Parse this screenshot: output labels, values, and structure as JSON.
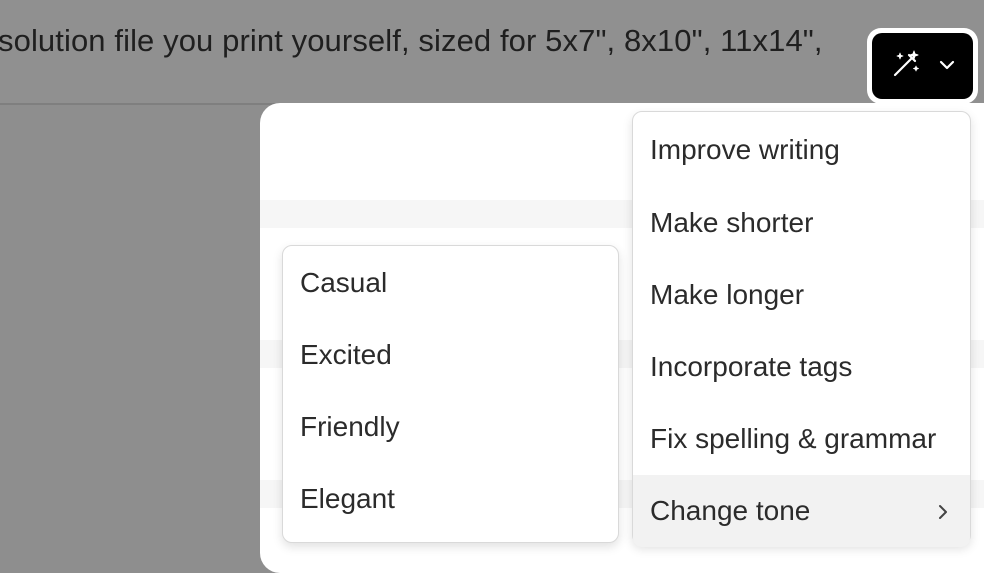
{
  "editor": {
    "text": "solution file you print yourself, sized for 5x7\", 8x10\", 11x14\","
  },
  "ai_button": {
    "icon": "magic-wand-icon",
    "dropdown_icon": "chevron-down-icon"
  },
  "ai_menu": {
    "items": [
      {
        "label": "Improve writing"
      },
      {
        "label": "Make shorter"
      },
      {
        "label": "Make longer"
      },
      {
        "label": "Incorporate tags"
      },
      {
        "label": "Fix spelling & grammar"
      },
      {
        "label": "Change tone",
        "submenu_icon": "chevron-right-icon"
      }
    ]
  },
  "tone_menu": {
    "items": [
      {
        "label": "Casual"
      },
      {
        "label": "Excited"
      },
      {
        "label": "Friendly"
      },
      {
        "label": "Elegant"
      }
    ]
  }
}
